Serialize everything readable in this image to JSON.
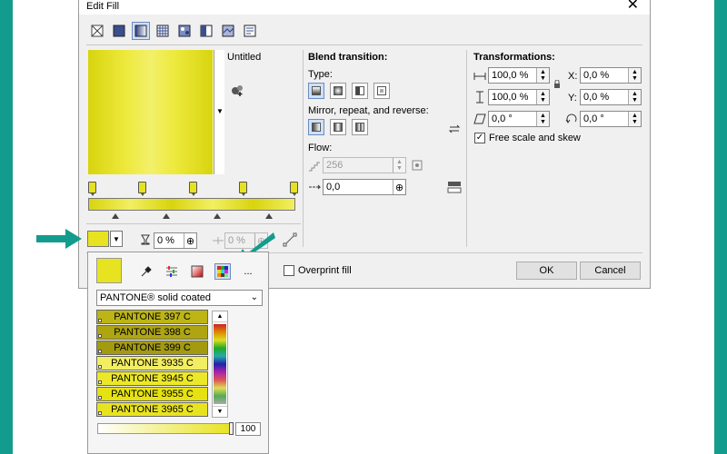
{
  "window": {
    "title": "Edit Fill",
    "close_glyph": "✕"
  },
  "fill_types": [
    {
      "name": "no-fill-icon",
      "selected": false
    },
    {
      "name": "uniform-fill-icon",
      "selected": false
    },
    {
      "name": "fountain-fill-icon",
      "selected": true
    },
    {
      "name": "vector-pattern-fill-icon",
      "selected": false
    },
    {
      "name": "bitmap-pattern-fill-icon",
      "selected": false
    },
    {
      "name": "two-color-pattern-fill-icon",
      "selected": false
    },
    {
      "name": "texture-fill-icon",
      "selected": false
    },
    {
      "name": "postscript-fill-icon",
      "selected": false
    }
  ],
  "preview": {
    "name": "Untitled"
  },
  "color_row": {
    "transparency_value": "0 %",
    "position_value": "0 %"
  },
  "blend": {
    "heading": "Blend transition:",
    "type_label": "Type:",
    "mirror_label": "Mirror, repeat, and reverse:",
    "flow_label": "Flow:",
    "flow_steps": "256",
    "acceleration": "0,0"
  },
  "transformations": {
    "heading": "Transformations:",
    "width": "100,0 %",
    "height": "100,0 %",
    "x_label": "X:",
    "x": "0,0 %",
    "y_label": "Y:",
    "y": "0,0 %",
    "skew": "0,0 °",
    "rotate": "0,0 °",
    "free_scale_label": "Free scale and skew",
    "free_scale_checked": true
  },
  "footer": {
    "overprint_label": "Overprint fill",
    "ok_label": "OK",
    "cancel_label": "Cancel"
  },
  "color_popup": {
    "palette_name": "PANTONE® solid coated",
    "more_label": "...",
    "swatches": [
      {
        "label": "PANTONE 397 C",
        "color": "#bdb515"
      },
      {
        "label": "PANTONE 398 C",
        "color": "#aea511"
      },
      {
        "label": "PANTONE 399 C",
        "color": "#a39a10"
      },
      {
        "label": "PANTONE 3935 C",
        "color": "#f2ee62"
      },
      {
        "label": "PANTONE 3945 C",
        "color": "#ece829"
      },
      {
        "label": "PANTONE 3955 C",
        "color": "#e6e212"
      },
      {
        "label": "PANTONE 3965 C",
        "color": "#e8e320"
      }
    ],
    "tint_value": "100"
  },
  "colors": {
    "accent_teal": "#139c8d",
    "selected_yellow": "#e8e320"
  }
}
